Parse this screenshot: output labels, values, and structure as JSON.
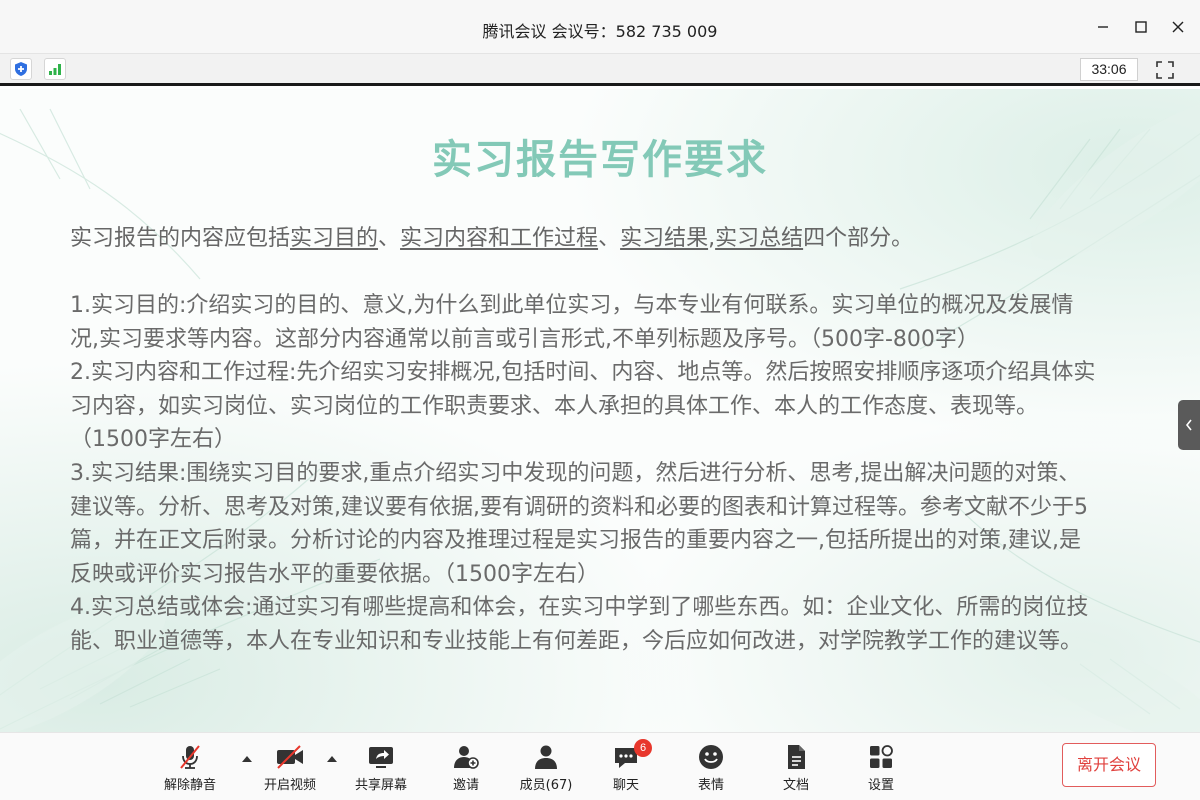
{
  "window": {
    "title": "腾讯会议 会议号：582 735 009"
  },
  "statusbar": {
    "timer": "33:06",
    "icons": [
      "shield-icon",
      "signal-icon",
      "fullscreen-icon"
    ],
    "colors": {
      "shield": "#2f6fe0",
      "signal": "#2fb34a"
    }
  },
  "slide": {
    "title": "实习报告写作要求",
    "intro_prefix": "实习报告的内容应包括",
    "intro_link1": "实习目的",
    "intro_sep1": "、",
    "intro_link2": "实习内容和工作过程",
    "intro_sep2": "、",
    "intro_link3": "实习结果",
    "intro_sep3": ",",
    "intro_link4": "实习总结",
    "intro_suffix": "四个部分。",
    "paragraphs": [
      "1.实习目的:介绍实习的目的、意义,为什么到此单位实习，与本专业有何联系。实习单位的概况及发展情况,实习要求等内容。这部分内容通常以前言或引言形式,不单列标题及序号。（500字-800字）",
      "2.实习内容和工作过程:先介绍实习安排概况,包括时间、内容、地点等。然后按照安排顺序逐项介绍具体实习内容，如实习岗位、实习岗位的工作职责要求、本人承担的具体工作、本人的工作态度、表现等。（1500字左右）",
      "3.实习结果:围绕实习目的要求,重点介绍实习中发现的问题，然后进行分析、思考,提出解决问题的对策、建议等。分析、思考及对策,建议要有依据,要有调研的资料和必要的图表和计算过程等。参考文献不少于5篇，并在正文后附录。分析讨论的内容及推理过程是实习报告的重要内容之一,包括所提出的对策,建议,是反映或评价实习报告水平的重要依据。（1500字左右）",
      "4.实习总结或体会:通过实习有哪些提高和体会，在实习中学到了哪些东西。如：企业文化、所需的岗位技能、职业道德等，本人在专业知识和专业技能上有何差距，今后应如何改进，对学院教学工作的建议等。"
    ],
    "title_color": "#83c9b7"
  },
  "toolbar": {
    "mute": "解除静音",
    "video": "开启视频",
    "share": "共享屏幕",
    "invite": "邀请",
    "members": "成员(67)",
    "chat": "聊天",
    "chat_badge": "6",
    "reactions": "表情",
    "docs": "文档",
    "settings": "设置",
    "leave": "离开会议",
    "leave_color": "#e0403d"
  }
}
